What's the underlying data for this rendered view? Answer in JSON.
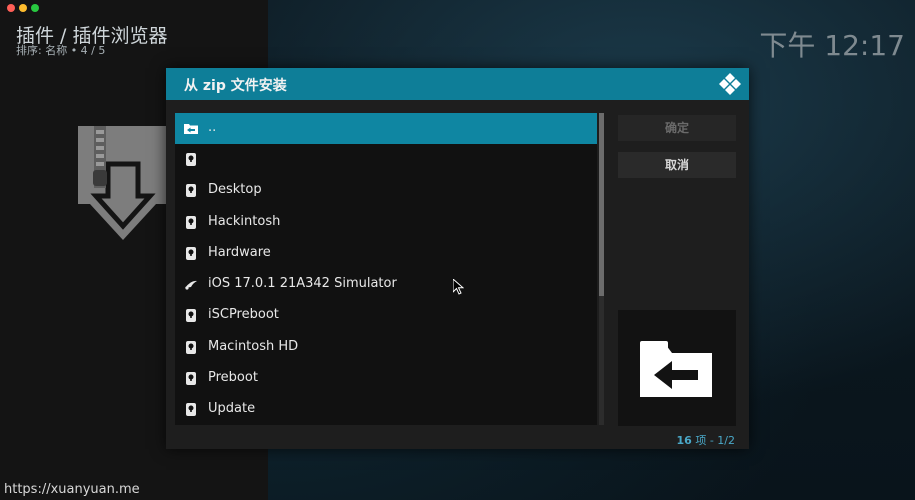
{
  "header": {
    "title": "插件 / 插件浏览器",
    "subtitle": "排序: 名称  •  4 / 5",
    "clock": "下午 12:17"
  },
  "dialog": {
    "title": "从 zip 文件安装",
    "items": [
      {
        "label": "..",
        "icon": "folder-back-icon",
        "selected": true
      },
      {
        "label": "",
        "icon": "drive-icon",
        "selected": false
      },
      {
        "label": "Desktop",
        "icon": "drive-icon",
        "selected": false
      },
      {
        "label": "Hackintosh",
        "icon": "drive-icon",
        "selected": false
      },
      {
        "label": "Hardware",
        "icon": "drive-icon",
        "selected": false
      },
      {
        "label": "iOS 17.0.1 21A342 Simulator",
        "icon": "network-icon",
        "selected": false
      },
      {
        "label": "iSCPreboot",
        "icon": "drive-icon",
        "selected": false
      },
      {
        "label": "Macintosh HD",
        "icon": "drive-icon",
        "selected": false
      },
      {
        "label": "Preboot",
        "icon": "drive-icon",
        "selected": false
      },
      {
        "label": "Update",
        "icon": "drive-icon",
        "selected": false
      }
    ],
    "ok_label": "确定",
    "cancel_label": "取消",
    "count_prefix": "16",
    "count_suffix": "项 - 1/2"
  },
  "colors": {
    "accent": "#0e7e98",
    "selected_row": "#0f86a2",
    "count_text": "#4aa8c8"
  },
  "watermark": "https://xuanyuan.me"
}
